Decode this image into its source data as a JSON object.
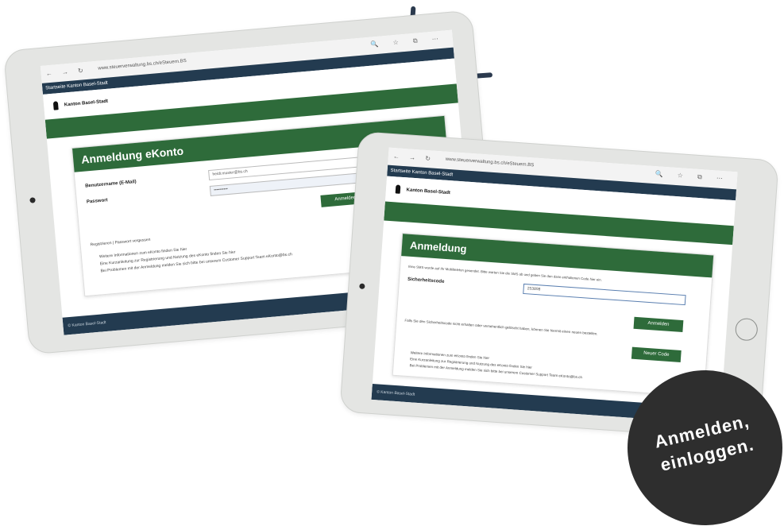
{
  "back_tablet": {
    "browser": {
      "nav_symbols": "← → ↻",
      "url": "www.steuerverwaltung.bs.ch/eSteuern.BS",
      "tool_symbols": "🔍 ☆ ⧉ ⋯"
    },
    "topnav_label": "Startseite Kanton Basel-Stadt",
    "logo_text": "Kanton Basel-Stadt",
    "card_title": "Anmeldung eKonto",
    "fields": [
      {
        "label": "Benutzername (E-Mail)",
        "value": "heidi.muster@bs.ch"
      },
      {
        "label": "Passwort",
        "value": "••••••••••"
      }
    ],
    "login_button": "Anmelden",
    "links_line": "Registrieren | Passwort vergessen",
    "bullets": [
      "Weitere Informationen zum eKonto finden Sie hier",
      "Eine Kurzanleitung zur Registrierung und Nutzung des eKonto finden Sie hier",
      "Bei Problemen mit der Anmeldung melden Sie sich bitte bei unserem Customer Support Team eKonto@bs.ch"
    ],
    "footer": "© Kanton Basel-Stadt"
  },
  "front_tablet": {
    "browser": {
      "nav_symbols": "← → ↻",
      "url": "www.steuerverwaltung.bs.ch/eSteuern.BS",
      "tool_symbols": "🔍 ☆ ⧉ ⋯"
    },
    "topnav_label": "Startseite Kanton Basel-Stadt",
    "logo_text": "Kanton Basel-Stadt",
    "card_title": "Anmeldung",
    "intro": "Eine SMS wurde auf Ihr Mobiltelefon gesendet. Bitte warten Sie die SMS ab und geben Sie den darin enthaltenen Code hier ein.",
    "code_label": "Sicherheitscode",
    "code_value": "253898",
    "login_button": "Anmelden",
    "resend_text": "Falls Sie den Sicherheitscode nicht erhalten oder versehentlich gelöscht haben, können Sie hiermit einen neuen bestellen.",
    "new_code_button": "Neuer Code",
    "bullets": [
      "Weitere Informationen zum eKonto finden Sie hier",
      "Eine Kurzanleitung zur Registrierung und Nutzung des eKonto finden Sie hier",
      "Bei Problemen mit der Anmeldung melden Sie sich bitte bei unserem Customer Support Team eKonto@bs.ch"
    ],
    "footer": "© Kanton Basel-Stadt"
  },
  "badge": {
    "line1": "Anmelden,",
    "line2": "einloggen."
  },
  "colors": {
    "accent_green": "#2e6b3a",
    "nav_navy": "#233b50",
    "badge_dark": "#2e2e2e"
  }
}
